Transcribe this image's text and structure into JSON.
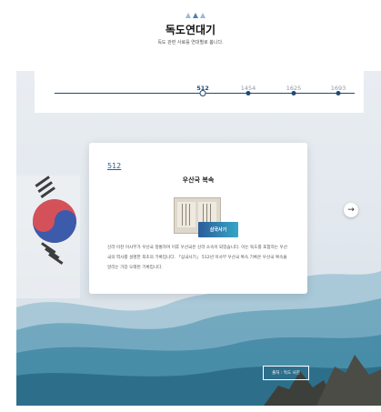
{
  "header": {
    "title": "독도연대기",
    "subtitle": "독도 관련 사료를 연대별로 봅니다."
  },
  "timeline": {
    "ticks": [
      {
        "label": "512",
        "active": true
      },
      {
        "label": "1454",
        "active": false
      },
      {
        "label": "1625",
        "active": false
      },
      {
        "label": "1693",
        "active": false
      }
    ]
  },
  "card": {
    "year": "512",
    "title": "우산국 복속",
    "badge": "삼국사기",
    "text": "신라 이찬 이사부가 우산국 정벌하며 이후 우산국은 신라 소속이 되었습니다. 이는 독도를 포함하는 우산국의 역사를 설명한 최초의 기록입니다. 「삼국사기」 512년 이사부 우산국 복속 기록은 우산국 복속을 알리는 가장 오래된 기록입니다."
  },
  "photo_caption": "출처 : 독도 사진",
  "icons": {
    "next": "arrow-right-icon",
    "decoration": "triangles-icon"
  },
  "colors": {
    "accent": "#1f4a72",
    "badge_start": "#2b5c9b",
    "badge_end": "#35a6c6",
    "year_link": "#2d5d9a"
  }
}
